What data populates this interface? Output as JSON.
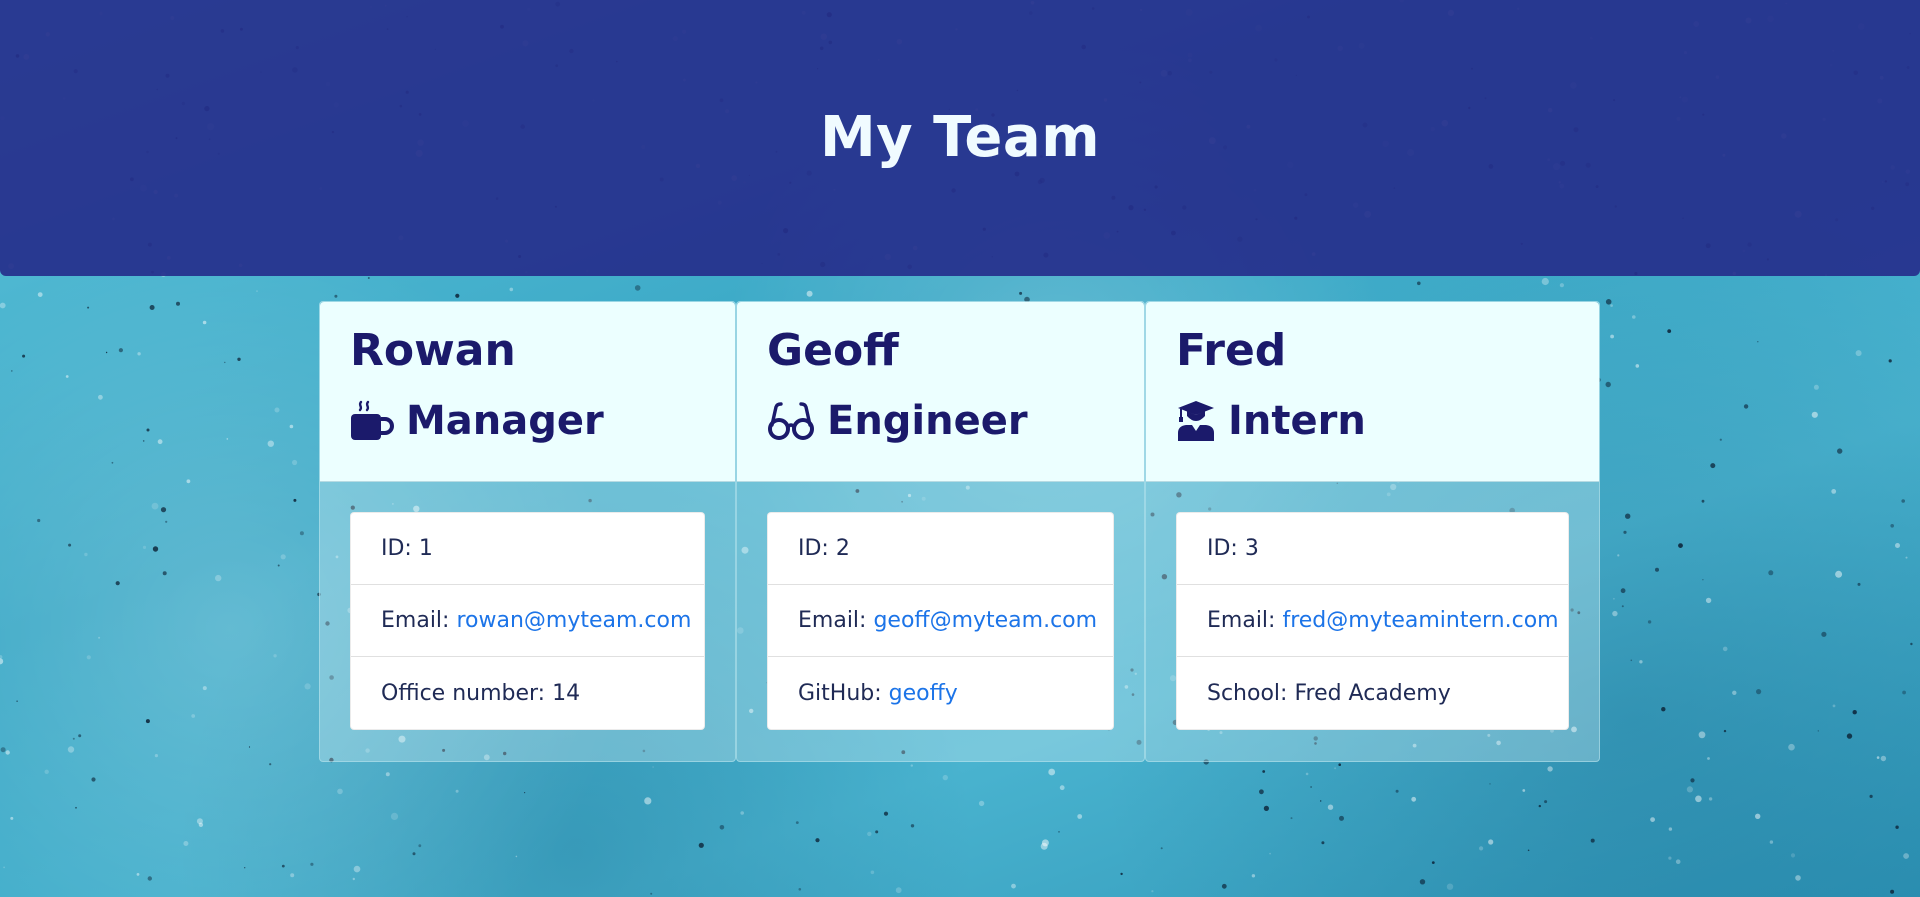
{
  "header": {
    "title": "My Team"
  },
  "team": [
    {
      "name": "Rowan",
      "role": "Manager",
      "role_icon": "coffee-mug-icon",
      "id_label": "ID:",
      "id_value": "1",
      "email_label": "Email:",
      "email": "rowan@myteam.com",
      "extra_label": "Office number:",
      "extra_value": "14"
    },
    {
      "name": "Geoff",
      "role": "Engineer",
      "role_icon": "glasses-icon",
      "id_label": "ID:",
      "id_value": "2",
      "email_label": "Email:",
      "email": "geoff@myteam.com",
      "extra_label": "GitHub:",
      "extra_value": "geoffy"
    },
    {
      "name": "Fred",
      "role": "Intern",
      "role_icon": "graduate-icon",
      "id_label": "ID:",
      "id_value": "3",
      "email_label": "Email:",
      "email": "fred@myteamintern.com",
      "extra_label": "School:",
      "extra_value": "Fred Academy"
    }
  ],
  "colors": {
    "header_bg": "#262f8c",
    "title_text": "#f0fbff",
    "card_header_bg": "#ecffff",
    "name_text": "#1b1a6b",
    "link": "#1c74e8",
    "background": "#3aa8c6"
  }
}
